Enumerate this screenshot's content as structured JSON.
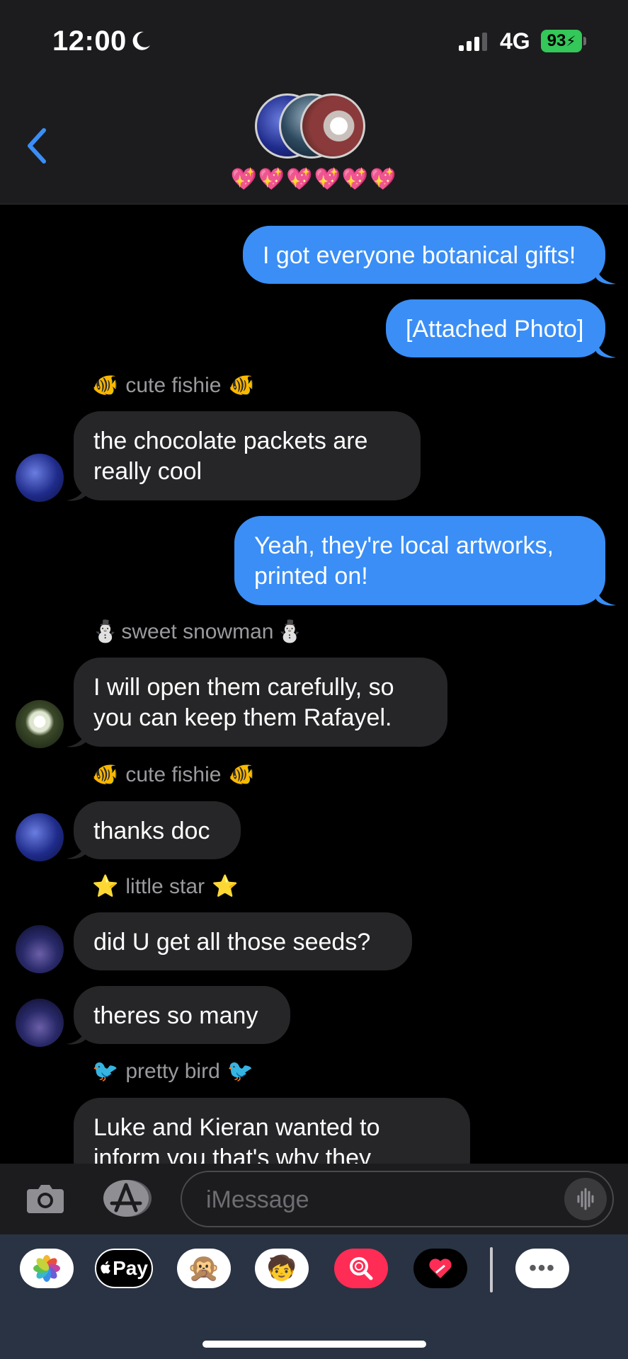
{
  "status": {
    "time": "12:00",
    "network": "4G",
    "battery": "93"
  },
  "header": {
    "group_name": "💖💖💖💖💖💖"
  },
  "messages": [
    {
      "text": "I got everyone botanical gifts!"
    },
    {
      "text": "[Attached Photo]"
    },
    {
      "sender": "cute fishie",
      "sender_emoji": "🐠",
      "line1": "the chocolate packets are",
      "line2": "really cool"
    },
    {
      "line1": "Yeah, they're local artworks,",
      "line2": "printed on!"
    },
    {
      "sender": "sweet snowman",
      "sender_emoji": "⛄",
      "line1": "I will open them carefully, so",
      "line2": "you can keep them Rafayel."
    },
    {
      "sender": "cute fishie",
      "sender_emoji": "🐠",
      "text": "thanks doc"
    },
    {
      "sender": "little star",
      "sender_emoji": "⭐",
      "text": "did U get all those seeds?"
    },
    {
      "text": "theres so many"
    },
    {
      "sender": "pretty bird",
      "sender_emoji": "🐦",
      "line1": "Luke and Kieran wanted to",
      "line2": "inform you that's why they"
    }
  ],
  "input": {
    "placeholder": "iMessage"
  },
  "dock": {
    "apple_pay_label": "Pay",
    "more_label": "•••"
  },
  "icons": [
    "moon-icon",
    "signal-icon",
    "battery-icon",
    "back-chevron-icon",
    "camera-icon",
    "app-store-icon",
    "audio-waveform-icon",
    "photos-icon",
    "apple-pay-icon",
    "memoji-monkey-icon",
    "memoji-avatar-icon",
    "search-images-icon",
    "digital-touch-icon",
    "more-icon"
  ],
  "colors": {
    "outgoing_bubble": "#3a8ef6",
    "incoming_bubble": "#262628",
    "accent": "#3a8ef6",
    "battery": "#34c759"
  }
}
